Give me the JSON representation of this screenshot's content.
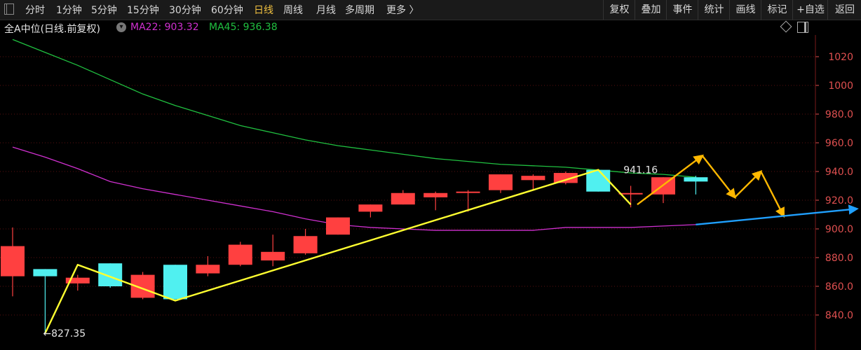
{
  "toolbar": {
    "periods": [
      "分时",
      "1分钟",
      "5分钟",
      "15分钟",
      "30分钟",
      "60分钟",
      "日线",
      "周线",
      "月线",
      "多周期",
      "更多 〉"
    ],
    "active_period": "日线",
    "right_buttons": [
      "复权",
      "叠加",
      "事件",
      "统计",
      "画线",
      "标记",
      "+自选",
      "返回"
    ]
  },
  "info": {
    "instrument": "全A中位(日线.前复权)",
    "ma22_label": "MA22: 903.32",
    "ma45_label": "MA45: 936.38"
  },
  "colors": {
    "background": "#000000",
    "up": "#ff4040",
    "down": "#50f0f0",
    "ma22": "#d030d0",
    "ma45": "#20c040",
    "wave_line": "#ffff30",
    "arrow": "#ffb800",
    "blue_arrow": "#20a0ff",
    "axis_text": "#e05050",
    "grid": "#5a1010"
  },
  "chart_data": {
    "type": "candlestick",
    "y_axis": {
      "ticks": [
        "840.0",
        "860.0",
        "880.0",
        "900.0",
        "920.0",
        "940.0",
        "960.0",
        "980.0",
        "1000",
        "1020"
      ],
      "range": [
        822,
        1045
      ]
    },
    "grid": true,
    "candles": [
      {
        "open": 867,
        "close": 888,
        "high": 901,
        "low": 853
      },
      {
        "open": 872,
        "close": 867,
        "high": 872,
        "low": 827.35
      },
      {
        "open": 862,
        "close": 866,
        "high": 868,
        "low": 857
      },
      {
        "open": 876,
        "close": 860,
        "high": 876,
        "low": 859
      },
      {
        "open": 852,
        "close": 868,
        "high": 870,
        "low": 851
      },
      {
        "open": 875,
        "close": 851,
        "high": 875,
        "low": 850
      },
      {
        "open": 869,
        "close": 875,
        "high": 881,
        "low": 867
      },
      {
        "open": 875,
        "close": 889,
        "high": 891,
        "low": 874
      },
      {
        "open": 878,
        "close": 884,
        "high": 896,
        "low": 874
      },
      {
        "open": 883,
        "close": 895,
        "high": 900,
        "low": 882
      },
      {
        "open": 896,
        "close": 908,
        "high": 908,
        "low": 896
      },
      {
        "open": 912,
        "close": 917,
        "high": 917,
        "low": 908
      },
      {
        "open": 917,
        "close": 925,
        "high": 927,
        "low": 917
      },
      {
        "open": 922,
        "close": 925,
        "high": 926,
        "low": 913
      },
      {
        "open": 926,
        "close": 926,
        "high": 927,
        "low": 912
      },
      {
        "open": 927,
        "close": 938,
        "high": 938,
        "low": 925
      },
      {
        "open": 934,
        "close": 937,
        "high": 938,
        "low": 927
      },
      {
        "open": 932,
        "close": 939,
        "high": 940,
        "low": 931
      },
      {
        "open": 941.16,
        "close": 926,
        "high": 941.16,
        "low": 926
      },
      {
        "open": 925,
        "close": 925,
        "high": 930,
        "low": 915
      },
      {
        "open": 924,
        "close": 936,
        "high": 936,
        "low": 918
      },
      {
        "open": 936,
        "close": 933,
        "high": 937,
        "low": 924
      }
    ],
    "ma22": [
      957,
      950,
      942,
      933,
      928,
      924,
      920,
      916,
      912,
      907,
      903,
      901,
      900,
      899,
      899,
      899,
      899,
      901,
      901,
      901,
      902,
      903
    ],
    "ma45": [
      1032,
      1023,
      1014,
      1004,
      994,
      986,
      979,
      972,
      967,
      962,
      958,
      955,
      952,
      949,
      947,
      945,
      944,
      943,
      941,
      939,
      938,
      936
    ],
    "wave_points": [
      [
        1,
        827.35
      ],
      [
        2,
        875
      ],
      [
        5,
        850
      ],
      [
        18,
        941.16
      ],
      [
        19,
        917
      ]
    ],
    "forecast_arrows": [
      [
        [
          19.2,
          917
        ],
        [
          21.2,
          951
        ]
      ],
      [
        [
          21.2,
          951
        ],
        [
          22.2,
          922
        ]
      ],
      [
        [
          22.2,
          922
        ],
        [
          23,
          940
        ]
      ],
      [
        [
          23,
          940
        ],
        [
          23.7,
          909
        ]
      ]
    ],
    "blue_arrow": [
      [
        21,
        903
      ],
      [
        26,
        914
      ]
    ],
    "annotations": {
      "low_label": "←827.35",
      "high_label": "941.16"
    }
  }
}
